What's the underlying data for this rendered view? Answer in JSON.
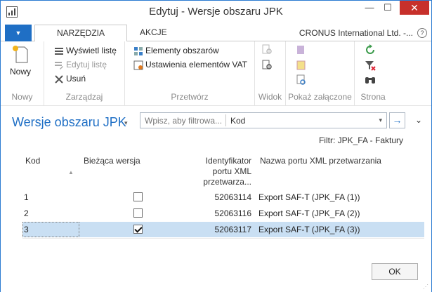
{
  "window": {
    "title": "Edytuj - Wersje obszaru JPK",
    "minimize_glyph": "—",
    "maximize_glyph": "☐",
    "close_glyph": "✕"
  },
  "ribbon_tabs": {
    "file_glyph": "▼",
    "home": "NARZĘDZIA GŁÓWNE",
    "actions": "AKCJE",
    "company": "CRONUS International Ltd. -...",
    "help_glyph": "?"
  },
  "ribbon": {
    "new_group": {
      "new_label": "Nowy",
      "group_label": "Nowy"
    },
    "manage_group": {
      "view_list": "Wyświetl listę",
      "edit_list": "Edytuj listę",
      "delete": "Usuń",
      "group_label": "Zarządzaj"
    },
    "process_group": {
      "area_elements": "Elementy obszarów",
      "vat_settings": "Ustawienia elementów VAT",
      "group_label": "Przetwórz"
    },
    "view_group": {
      "group_label": "Widok"
    },
    "attachments_group": {
      "group_label": "Pokaż załączone"
    },
    "page_group": {
      "group_label": "Strona"
    }
  },
  "page": {
    "title": "Wersje obszaru JPK",
    "title_caret": "▾",
    "filter_placeholder": "Wpisz, aby filtrowa...",
    "filter_field": "Kod",
    "filter_caret": "▾",
    "go_glyph": "→",
    "collapse_glyph": "⌄",
    "active_filter": "Filtr: JPK_FA - Faktury"
  },
  "table": {
    "headers": {
      "code": "Kod",
      "current_version": "Bieżąca wersja",
      "xml_port_id_1": "Identyfikator",
      "xml_port_id_2": "portu XML",
      "xml_port_id_3": "przetwarza...",
      "xml_port_name": "Nazwa portu XML przetwarzania"
    },
    "sort_glyph": "▲",
    "rows": [
      {
        "code": "1",
        "current": false,
        "port_id": "52063114",
        "port_name": "Export SAF-T (JPK_FA (1))"
      },
      {
        "code": "2",
        "current": false,
        "port_id": "52063116",
        "port_name": "Export SAF-T (JPK_FA (2))"
      },
      {
        "code": "3",
        "current": true,
        "port_id": "52063117",
        "port_name": "Export SAF-T (JPK_FA (3))"
      }
    ]
  },
  "footer": {
    "ok_label": "OK"
  },
  "colors": {
    "accent": "#1f6fc5",
    "selection": "#c9dff3",
    "close": "#c7302b"
  }
}
